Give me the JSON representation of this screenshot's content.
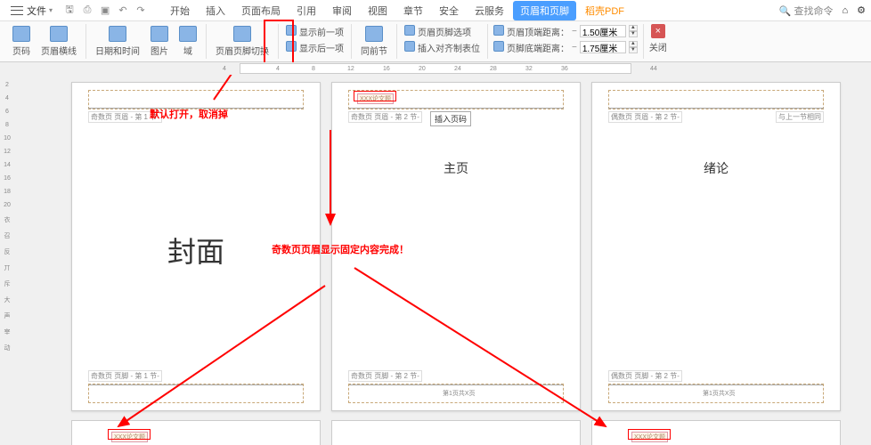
{
  "topbar": {
    "file": "文件",
    "search": "查找命令"
  },
  "tabs": [
    "开始",
    "插入",
    "页面布局",
    "引用",
    "审阅",
    "视图",
    "章节",
    "安全",
    "云服务",
    "页眉和页脚",
    "稻壳PDF"
  ],
  "activeTab": 9,
  "ribbon": {
    "pagenum": "页码",
    "hline": "页眉横线",
    "datetime": "日期和时间",
    "pic": "图片",
    "field": "域",
    "switch": "页眉页脚切换",
    "showPrev": "显示前一项",
    "showNext": "显示后一项",
    "sameAsPrev": "同前节",
    "hfOptions": "页眉页脚选项",
    "insertTab": "插入对齐制表位",
    "topDist": "页眉顶端距离：",
    "botDist": "页脚底端距离：",
    "topVal": "1.50厘米",
    "botVal": "1.75厘米",
    "close": "关闭"
  },
  "annotations": {
    "cancel": "默认打开，取消掉",
    "done": "奇数页页眉显示固定内容完成！"
  },
  "pages": {
    "p1": {
      "hdrTag": "奇数页 页眉 - 第 1 节-",
      "ftrTag": "奇数页 页脚 - 第 1 节-",
      "title": "封面"
    },
    "p2": {
      "hdrTag": "奇数页 页眉 - 第 2 节-",
      "ftrTag": "奇数页 页脚 - 第 2 节-",
      "title": "主页",
      "insertBtn": "插入页码",
      "fix": "XXX论文题",
      "ftFix": "第1页共X页"
    },
    "p3": {
      "hdrTag": "偶数页 页眉 - 第 2 节-",
      "ftrTag": "偶数页 页脚 - 第 2 节-",
      "title": "绪论",
      "same": "与上一节相同",
      "ftFix": "第1页共X页"
    }
  },
  "rulerMarks": [
    "4",
    "4",
    "8",
    "12",
    "16",
    "20",
    "24",
    "28",
    "32",
    "36",
    "44"
  ]
}
